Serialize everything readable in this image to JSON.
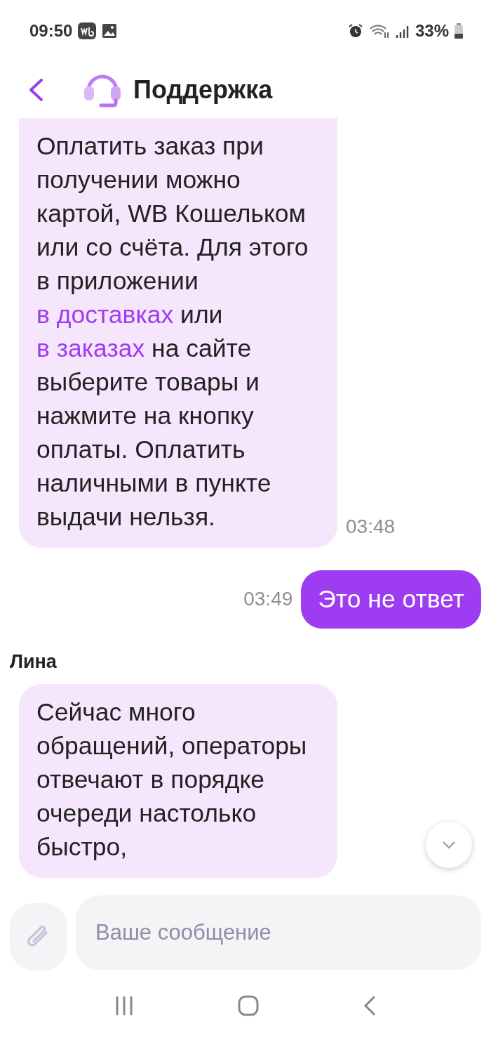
{
  "status_bar": {
    "time": "09:50",
    "battery": "33%"
  },
  "header": {
    "title": "Поддержка"
  },
  "messages": [
    {
      "kind": "incoming",
      "time": "03:48",
      "parts": [
        {
          "kind": "text",
          "text": "Оплатить заказ при получении можно картой, WB Кошельком или со счёта. Для этого в приложении "
        },
        {
          "kind": "link",
          "text": "в доставках"
        },
        {
          "kind": "text",
          "text": " или "
        },
        {
          "kind": "link",
          "text": "в заказах"
        },
        {
          "kind": "text",
          "text": " на сайте выберите товары и нажмите на кнопку оплаты. Оплатить наличными в пункте выдачи нельзя."
        }
      ]
    },
    {
      "kind": "outgoing",
      "time": "03:49",
      "parts": [
        {
          "kind": "text",
          "text": "Это не ответ"
        }
      ]
    },
    {
      "kind": "incoming",
      "sender": "Лина",
      "parts": [
        {
          "kind": "text",
          "text": "Сейчас много обращений, операторы отвечают в порядке очереди настолько быстро,"
        }
      ]
    }
  ],
  "composer": {
    "placeholder": "Ваше сообщение"
  }
}
